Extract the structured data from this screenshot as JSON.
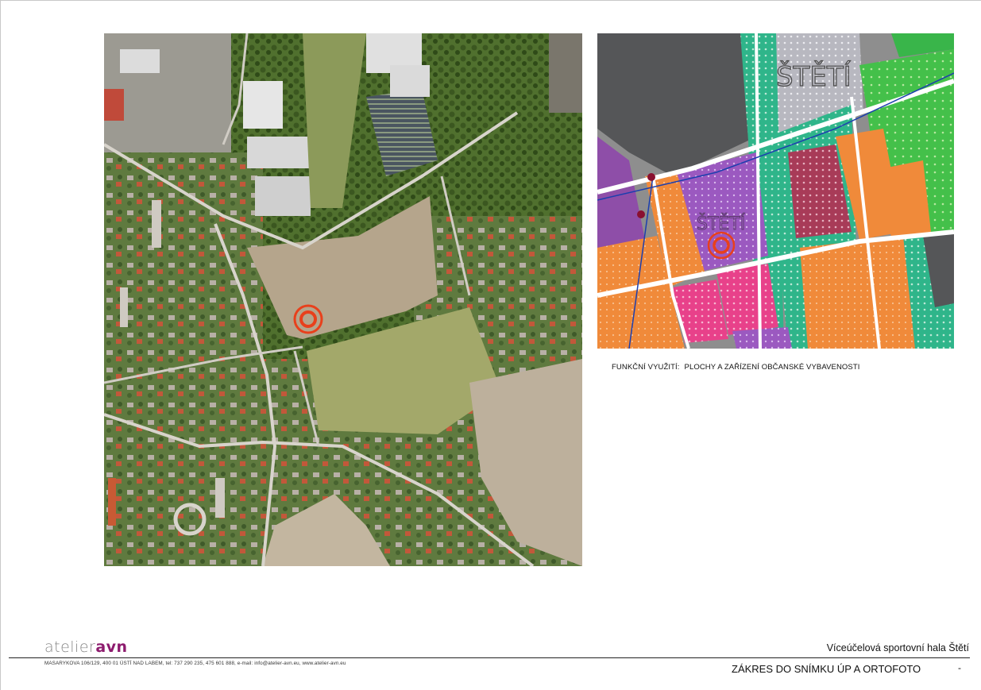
{
  "zoning_map": {
    "label_top": "ŠTĚTÍ",
    "label_center": "ŠTĚTÍ",
    "caption_key": "FUNKČNÍ VYUŽITÍ:",
    "caption_value": "PLOCHY A ZAŘÍZENÍ OBČANSKÉ VYBAVENOSTI"
  },
  "footer": {
    "logo_prefix": "atelier",
    "logo_suffix": "avn",
    "project_title": "Víceúčelová sportovní hala Štětí",
    "address": "MASARYKOVA 106/129, 400 01 ÚSTÍ NAD LABEM, tel: 737 290 235, 475 601 888, e-mail: info@atelier-avn.eu, www.atelier-avn.eu",
    "sheet_title": "ZÁKRES DO SNÍMKU ÚP A ORTOFOTO",
    "sheet_number": "-"
  },
  "colors": {
    "marker": "#e8401c",
    "brand": "#8d1b6e",
    "zone_civic": "#9b59c0",
    "zone_residential": "#f08a3a",
    "zone_green": "#2fb58a",
    "zone_industrial": "#5a5a5a"
  }
}
